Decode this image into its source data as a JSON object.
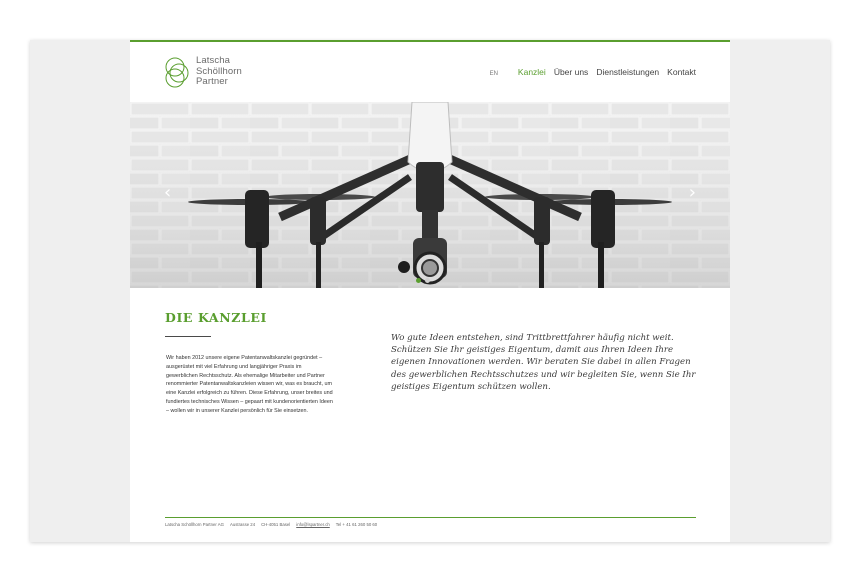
{
  "brand": {
    "name_line1": "Latscha",
    "name_line2": "Schöllhorn",
    "name_line3": "Partner",
    "color_green": "#5a9e2f"
  },
  "nav": {
    "lang": "EN",
    "items": [
      "Kanzlei",
      "Über uns",
      "Dienstleistungen",
      "Kontakt"
    ],
    "active": "Kanzlei"
  },
  "hero": {
    "image": "drone-photo",
    "prev_icon": "chevron-left-icon",
    "next_icon": "chevron-right-icon",
    "prev_glyph": "‹",
    "next_glyph": "›",
    "slides_active": 1
  },
  "content": {
    "heading": "DIE KANZLEI",
    "body": "Wir haben 2012 unsere eigene Patentanwaltskanzlei gegründet – ausgerüstet mit viel Erfahrung und langjähriger Praxis im gewerblichen Rechtsschutz. Als ehemalige Mitarbeiter und Partner renommierter Patentanwaltskanzleien wissen wir, was es braucht, um eine Kanzlei erfolgreich zu führen. Diese Erfahrung, unser breites und fundiertes technisches Wissen – gepaart mit kundenorientierten Ideen – wollen wir in unserer Kanzlei persönlich für Sie einsetzen.",
    "lead": "Wo gute Ideen entstehen, sind Trittbrettfahrer häufig nicht weit. Schützen Sie Ihr geistiges Eigentum, damit aus Ihren Ideen Ihre eigenen Innovationen werden. Wir beraten Sie dabei in allen Fragen des gewerblichen Rechtsschutzes und wir begleiten Sie, wenn Sie Ihr geistiges Eigentum schützen wollen."
  },
  "footer": {
    "company": "Latscha Schöllhorn Partner AG",
    "street": "Austrasse 24",
    "city": "CH-4051 Basel",
    "email": "info@lspartner.ch",
    "phone": "Tel + 41 61 260 50 60"
  }
}
